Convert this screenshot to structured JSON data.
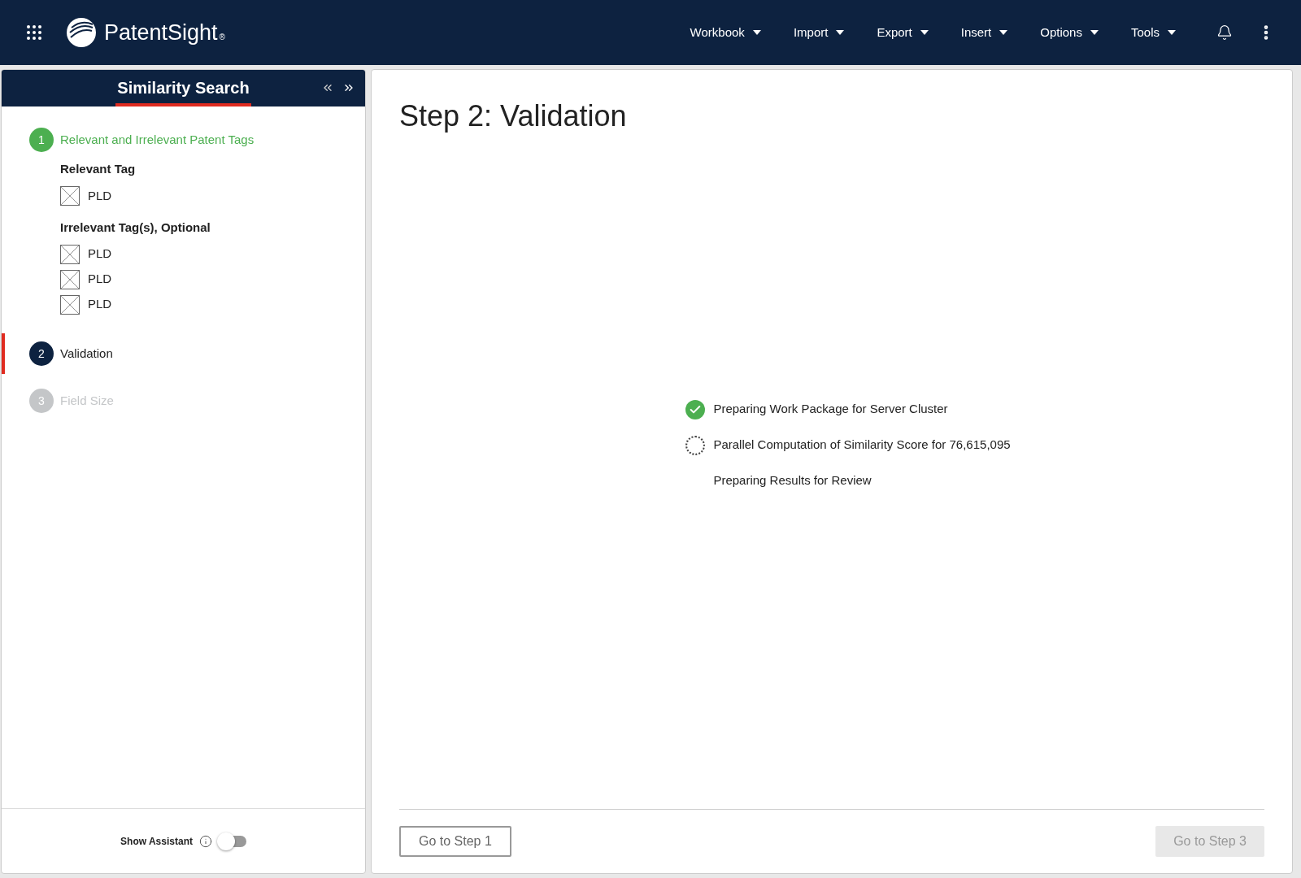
{
  "header": {
    "brand": "PatentSight",
    "brand_mark": "®",
    "menus": [
      {
        "label": "Workbook"
      },
      {
        "label": "Import"
      },
      {
        "label": "Export"
      },
      {
        "label": "Insert"
      },
      {
        "label": "Options"
      },
      {
        "label": "Tools"
      }
    ]
  },
  "sidebar": {
    "title": "Similarity Search",
    "steps": [
      {
        "number": "1",
        "label": "Relevant and Irrelevant Patent Tags",
        "kind": "done",
        "groups": [
          {
            "heading": "Relevant Tag",
            "tags": [
              "PLD"
            ]
          },
          {
            "heading": "Irrelevant Tag(s), Optional",
            "tags": [
              "PLD",
              "PLD",
              "PLD"
            ]
          }
        ]
      },
      {
        "number": "2",
        "label": "Validation",
        "kind": "active"
      },
      {
        "number": "3",
        "label": "Field Size",
        "kind": "pending"
      }
    ],
    "assistant": {
      "label": "Show Assistant",
      "on": false
    }
  },
  "main": {
    "title": "Step 2: Validation",
    "progress": [
      {
        "label": "Preparing Work Package for Server Cluster",
        "kind": "done"
      },
      {
        "label": "Parallel Computation of Similarity Score for 76,615,095",
        "kind": "running"
      },
      {
        "label": "Preparing Results for Review",
        "kind": "pending"
      }
    ],
    "buttons": [
      {
        "label": "Go to Step 1",
        "disabled": false
      },
      {
        "label": "Go to Step 3",
        "disabled": true
      }
    ]
  }
}
